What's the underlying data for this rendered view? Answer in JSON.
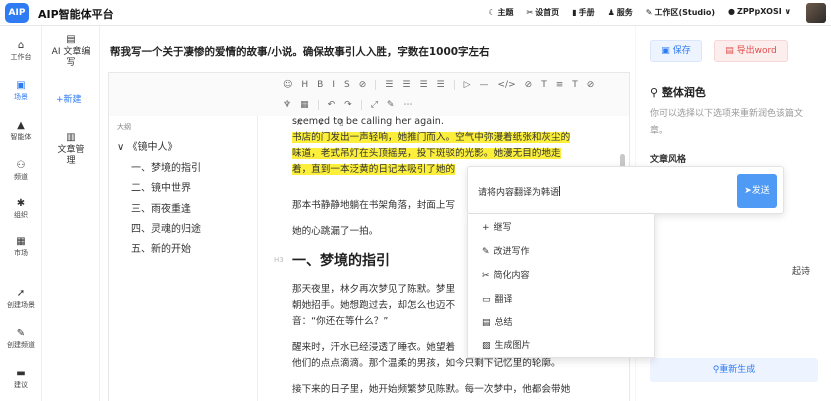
{
  "app": {
    "logo": "AIP",
    "title": "AIP智能体平台"
  },
  "header": {
    "nav": [
      {
        "icon": "moon-icon",
        "glyph": "☾",
        "label": "主题"
      },
      {
        "icon": "home-icon",
        "glyph": "✂",
        "label": "设首页"
      },
      {
        "icon": "book-icon",
        "glyph": "▮",
        "label": "手册"
      },
      {
        "icon": "service-icon",
        "glyph": "♟",
        "label": "服务"
      },
      {
        "icon": "pen-icon",
        "glyph": "✎",
        "label": "工作区(Studio)"
      },
      {
        "icon": "user-icon",
        "glyph": "●",
        "label": "ZPPpXOSI"
      }
    ],
    "chevron": "∨"
  },
  "leftnav": [
    {
      "icon": "workbench-icon",
      "glyph": "⌂",
      "label": "工作台",
      "active": false
    },
    {
      "icon": "square-icon",
      "glyph": "▣",
      "label": "场景",
      "active": true
    },
    {
      "icon": "agent-icon",
      "glyph": "▲",
      "label": "智能体",
      "active": false
    },
    {
      "icon": "channel-icon",
      "glyph": "⚇",
      "label": "频道",
      "active": false
    },
    {
      "icon": "org-icon",
      "glyph": "✱",
      "label": "组织",
      "active": false
    },
    {
      "icon": "market-icon",
      "glyph": "▦",
      "label": "市场",
      "active": false
    },
    {
      "icon": "create-scene-icon",
      "glyph": "➚",
      "label": "创建场景",
      "active": false
    },
    {
      "icon": "create-channel-icon",
      "glyph": "✎",
      "label": "创建频道",
      "active": false
    },
    {
      "icon": "feedback-icon",
      "glyph": "▬",
      "label": "建议",
      "active": false
    }
  ],
  "sidepanel": {
    "item1": "AI 文章编写",
    "new_label": "+新建",
    "item2": "文章管理"
  },
  "main": {
    "prompt": "帮我写一个关于凄惨的爱情的故事/小说。确保故事引人入胜，字数在1000字左右",
    "toolbar_row1": [
      "☺",
      "H",
      "B",
      "I",
      "S",
      "⊘",
      "|",
      "☰",
      "☰",
      "☰",
      "☰",
      "|",
      "▷",
      "—",
      "</>",
      "⊘",
      "T",
      "≡",
      "T",
      "⊘"
    ],
    "toolbar_row2": [
      "♆",
      "▦",
      "|",
      "↶",
      "↷",
      "|",
      "⤢",
      "✎",
      "⋯"
    ]
  },
  "outline": {
    "label": "大纲",
    "root": "《镜中人》",
    "root_toggle": "∨",
    "items": [
      "一、梦境的指引",
      "二、镜中世界",
      "三、雨夜重逢",
      "四、灵魂的归途",
      "五、新的开始"
    ]
  },
  "editor": {
    "mini_icons": "∧ ∨ ▯",
    "line_top": "seemed to be calling her again.",
    "highlight_lines": [
      "书店的门发出一声轻响，她推门而入。空气中弥漫着纸张和灰尘的",
      "味道，老式吊灯在头顶摇晃，投下斑驳的光影。她漫无目的地走",
      "着，直到一本泛黄的日记本吸引了她的"
    ],
    "p2": "那本书静静地躺在书架角落，封面上写",
    "p3": "她的心跳漏了一拍。",
    "h3_tag": "H3",
    "heading": "一、梦境的指引",
    "p4_lines": [
      "那天夜里，林夕再次梦见了陈默。梦里",
      "朝她招手。她想跑过去，却怎么也迈不",
      "音：“你还在等什么？”"
    ],
    "p5_lines": [
      "醒来时，汗水已经浸透了睡衣。她望着",
      "他们的点点滴滴。那个温柔的男孩，如今只剩下记忆里的轮廓。"
    ],
    "p6_lines": [
      "接下来的日子里，她开始频繁梦见陈默。每一次梦中，他都会带她"
    ]
  },
  "popup": {
    "input_value": "请将内容翻译为韩语",
    "send_label": "发送",
    "send_icon": "➤",
    "menu": [
      {
        "icon": "plus-icon",
        "glyph": "+",
        "label": "继写"
      },
      {
        "icon": "brush-icon",
        "glyph": "✎",
        "label": "改进写作"
      },
      {
        "icon": "scissors-icon",
        "glyph": "✂",
        "label": "简化内容"
      },
      {
        "icon": "translate-icon",
        "glyph": "▭",
        "label": "翻译"
      },
      {
        "icon": "summary-icon",
        "glyph": "▤",
        "label": "总结"
      },
      {
        "icon": "image-icon",
        "glyph": "▨",
        "label": "生成图片"
      }
    ]
  },
  "right": {
    "save": "保存",
    "save_icon": "▣",
    "export": "导出word",
    "export_icon": "▤",
    "title_icon": "⚲",
    "title": "整体润色",
    "desc": "你可以选择以下选项来重新润色该篇文章。",
    "style_label": "文章风格",
    "peek_text": "起诗",
    "regen": "重新生成",
    "regen_icon": "⚲"
  },
  "colors": {
    "accent": "#2f7bf2",
    "highlight": "#fbef3c",
    "danger": "#e14c4c"
  }
}
